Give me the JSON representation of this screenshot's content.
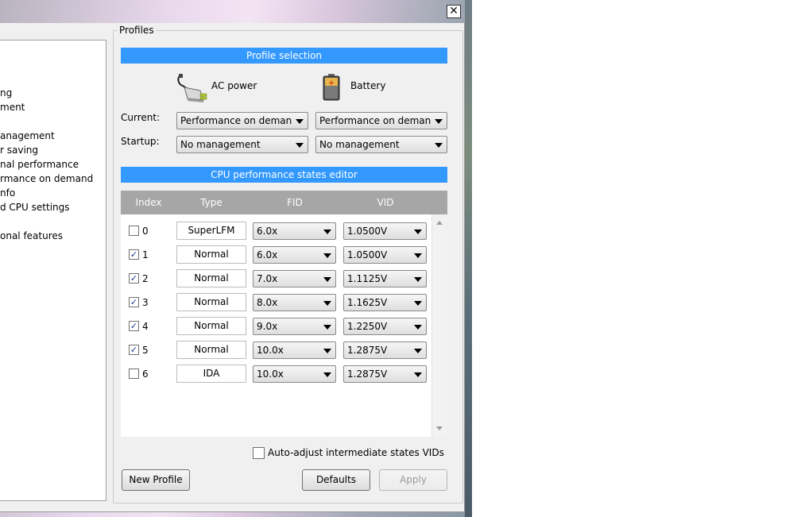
{
  "window": {
    "close_glyph": "✕"
  },
  "tree": {
    "items": [
      "ng",
      "ment",
      "anagement",
      "r saving",
      "nal performance",
      "rmance on demand",
      "nfo",
      "d CPU settings",
      "onal features"
    ]
  },
  "group": {
    "label": "Profiles"
  },
  "profile_selection": {
    "banner": "Profile selection",
    "ac_label": "AC power",
    "battery_label": "Battery",
    "current_label": "Current:",
    "startup_label": "Startup:",
    "ac_current": "Performance on demand",
    "bat_current": "Performance on demand",
    "ac_startup": "No management",
    "bat_startup": "No management"
  },
  "editor": {
    "banner": "CPU performance states editor",
    "columns": [
      "Index",
      "Type",
      "FID",
      "VID"
    ],
    "rows": [
      {
        "index": "0",
        "checked": false,
        "type": "SuperLFM",
        "fid": "6.0x",
        "vid": "1.0500V"
      },
      {
        "index": "1",
        "checked": true,
        "type": "Normal",
        "fid": "6.0x",
        "vid": "1.0500V"
      },
      {
        "index": "2",
        "checked": true,
        "type": "Normal",
        "fid": "7.0x",
        "vid": "1.1125V"
      },
      {
        "index": "3",
        "checked": true,
        "type": "Normal",
        "fid": "8.0x",
        "vid": "1.1625V"
      },
      {
        "index": "4",
        "checked": true,
        "type": "Normal",
        "fid": "9.0x",
        "vid": "1.2250V"
      },
      {
        "index": "5",
        "checked": true,
        "type": "Normal",
        "fid": "10.0x",
        "vid": "1.2875V"
      },
      {
        "index": "6",
        "checked": false,
        "type": "IDA",
        "fid": "10.0x",
        "vid": "1.2875V"
      }
    ],
    "auto_adjust_label": "Auto-adjust intermediate states VIDs",
    "auto_adjust_checked": false
  },
  "buttons": {
    "new_profile": "New Profile",
    "defaults": "Defaults",
    "apply": "Apply"
  },
  "colors": {
    "banner": "#3399ff",
    "table_header": "#a6a6a6",
    "check": "#1a3d8f"
  }
}
